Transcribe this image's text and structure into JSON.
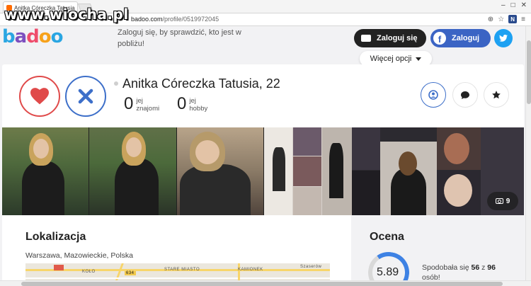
{
  "browser": {
    "tab_title": "Anitka Córeczka Tatusia",
    "url_host": "badoo.com",
    "url_path": "/profile/0519972045",
    "window_controls": [
      "–",
      "□",
      "✕"
    ]
  },
  "watermark": "www.wiocha.pl",
  "header": {
    "logo": [
      "b",
      "a",
      "d",
      "o",
      "o"
    ],
    "message": "Zaloguj się, by sprawdzić, kto jest w pobliżu!",
    "login_label": "Zaloguj się",
    "facebook_label": "Zaloguj",
    "more_options_label": "Więcej opcji"
  },
  "profile": {
    "name": "Anitka Córeczka Tatusia, 22",
    "friends_count": "0",
    "friends_label_1": "jej",
    "friends_label_2": "znajomi",
    "hobby_count": "0",
    "hobby_label_1": "jej",
    "hobby_label_2": "hobby"
  },
  "photos": {
    "count": "9"
  },
  "location": {
    "title": "Lokalizacja",
    "text": "Warszawa, Mazowieckie, Polska",
    "map_labels": [
      "KOŁO",
      "634",
      "STARE MIASTO",
      "KAMIONEK",
      "Szaserów"
    ]
  },
  "rating": {
    "title": "Ocena",
    "score": "5.89",
    "text_prefix": "Spodobała się",
    "liked": "56",
    "text_mid": "z",
    "total": "96",
    "text_suffix": "osób!",
    "accent": "#3e82e4"
  },
  "colors": {
    "like": "#e04a4a",
    "pass": "#3d6fc9",
    "facebook": "#3b64c4",
    "twitter": "#1da1f2"
  }
}
